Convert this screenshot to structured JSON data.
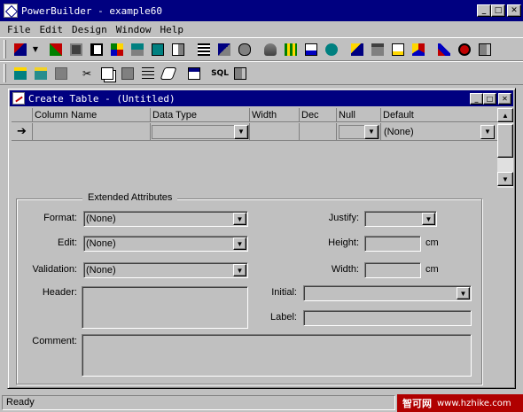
{
  "app": {
    "title": "PowerBuilder - example60",
    "window_buttons": [
      "_",
      "□",
      "✕"
    ]
  },
  "menu": {
    "items": [
      "File",
      "Edit",
      "Design",
      "Window",
      "Help"
    ]
  },
  "toolbar1": {
    "icons": [
      "new-icon",
      "open-icon",
      "application-icon",
      "window-icon",
      "menu-icon",
      "structure-icon",
      "function-icon",
      "datawindow-icon",
      "query-icon",
      "pipeline-icon",
      "user-object-icon",
      "database-icon",
      "data-pipeline-icon",
      "project-icon",
      "library-icon",
      "debug-icon",
      "run-icon",
      "browser-icon",
      "edit-icon",
      "help-icon",
      "run-man-icon",
      "stop-icon",
      "exit-icon"
    ]
  },
  "toolbar2": {
    "icons": [
      "create-table-icon",
      "open-table-icon",
      "save-icon",
      "cut-icon",
      "copy-icon",
      "paste-icon",
      "insert-row-icon",
      "clear-icon",
      "properties-icon",
      "sql-icon",
      "close-icon"
    ],
    "sql_label": "SQL"
  },
  "child": {
    "title": "Create Table - (Untitled)"
  },
  "grid": {
    "columns": [
      "Column Name",
      "Data Type",
      "Width",
      "Dec",
      "Null",
      "Default"
    ],
    "row": {
      "indicator": "➔",
      "column_name": "",
      "data_type": "",
      "width": "",
      "dec": "",
      "null": "",
      "default": "(None)"
    }
  },
  "extended": {
    "legend": "Extended Attributes",
    "format_label": "Format:",
    "format_value": "(None)",
    "edit_label": "Edit:",
    "edit_value": "(None)",
    "validation_label": "Validation:",
    "validation_value": "(None)",
    "header_label": "Header:",
    "comment_label": "Comment:",
    "justify_label": "Justify:",
    "justify_value": "",
    "height_label": "Height:",
    "height_value": "",
    "height_unit": "cm",
    "width_label": "Width:",
    "width_value": "",
    "width_unit": "cm",
    "initial_label": "Initial:",
    "initial_value": "",
    "label_label": "Label:",
    "label_value": ""
  },
  "status": {
    "text": "Ready",
    "watermark_brand": "智可网",
    "watermark_url": "www.hzhike.com"
  },
  "colors": {
    "title_bar": "#000080",
    "face": "#c0c0c0",
    "watermark": "#b00000"
  }
}
